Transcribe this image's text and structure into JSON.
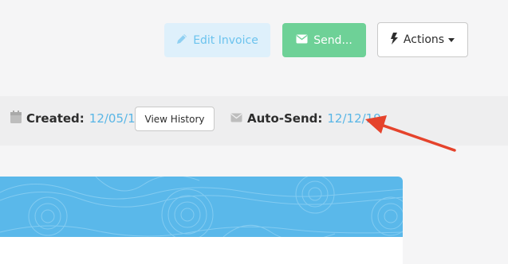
{
  "toolbar": {
    "edit_label": "Edit Invoice",
    "send_label": "Send...",
    "actions_label": "Actions"
  },
  "meta": {
    "created_label": "Created:",
    "created_value": "12/05/19",
    "history_label": "View History",
    "autosend_label": "Auto-Send:",
    "autosend_value": "12/12/19"
  },
  "icons": {
    "edit": "pencil-icon",
    "send": "envelope-icon",
    "actions": "bolt-icon",
    "created": "calendar-icon",
    "autosend": "envelope-icon"
  },
  "colors": {
    "edit_bg": "#def0fb",
    "edit_text": "#6bc3ee",
    "send_bg": "#6ed197",
    "link_blue": "#59b6e6",
    "banner": "#5ab8ea",
    "annotation_arrow": "#e5432c"
  }
}
